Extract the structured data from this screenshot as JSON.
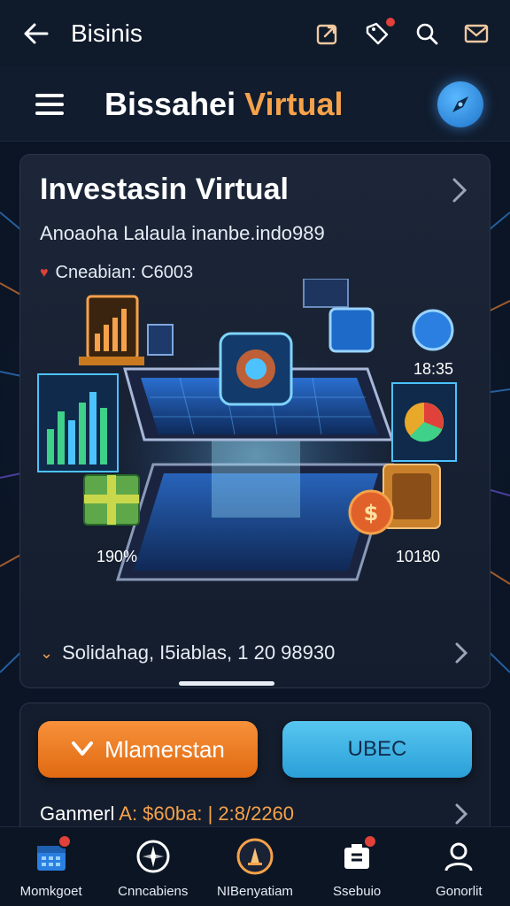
{
  "topbar": {
    "title": "Bisinis",
    "icons": [
      "share-icon",
      "tag-icon",
      "search-icon",
      "mail-icon"
    ]
  },
  "header": {
    "brand_part1": "Bissahei",
    "brand_part2": "Virtual",
    "colors": {
      "accent": "#f5a24a",
      "compass": "#2a8be0"
    }
  },
  "card": {
    "title": "Investasin Virtual",
    "subtitle": "Anoaoha Lalaula inanbe.indo989",
    "meta": "Cneabian: C6003",
    "labels": {
      "top_right": "18:35",
      "bottom_left": "190%",
      "bottom_right": "10180"
    },
    "footer": "Solidahag, I5iablas, 1 20 98930"
  },
  "actions": {
    "primary_label": "Mlamerstan",
    "secondary_label": "UBEC",
    "summary_prefix": "Ganmerl",
    "summary_accent": "A: $60ba: | 2:8/2260"
  },
  "nav": {
    "items": [
      {
        "label": "Momkgoet",
        "icon": "calendar-icon",
        "badge": true
      },
      {
        "label": "Cnncabiens",
        "icon": "compass-icon",
        "badge": false
      },
      {
        "label": "NIBenyatiam",
        "icon": "profile-badge-icon",
        "badge": false
      },
      {
        "label": "Ssebuio",
        "icon": "wallet-icon",
        "badge": true
      },
      {
        "label": "Gonorlit",
        "icon": "user-icon",
        "badge": false
      }
    ]
  }
}
